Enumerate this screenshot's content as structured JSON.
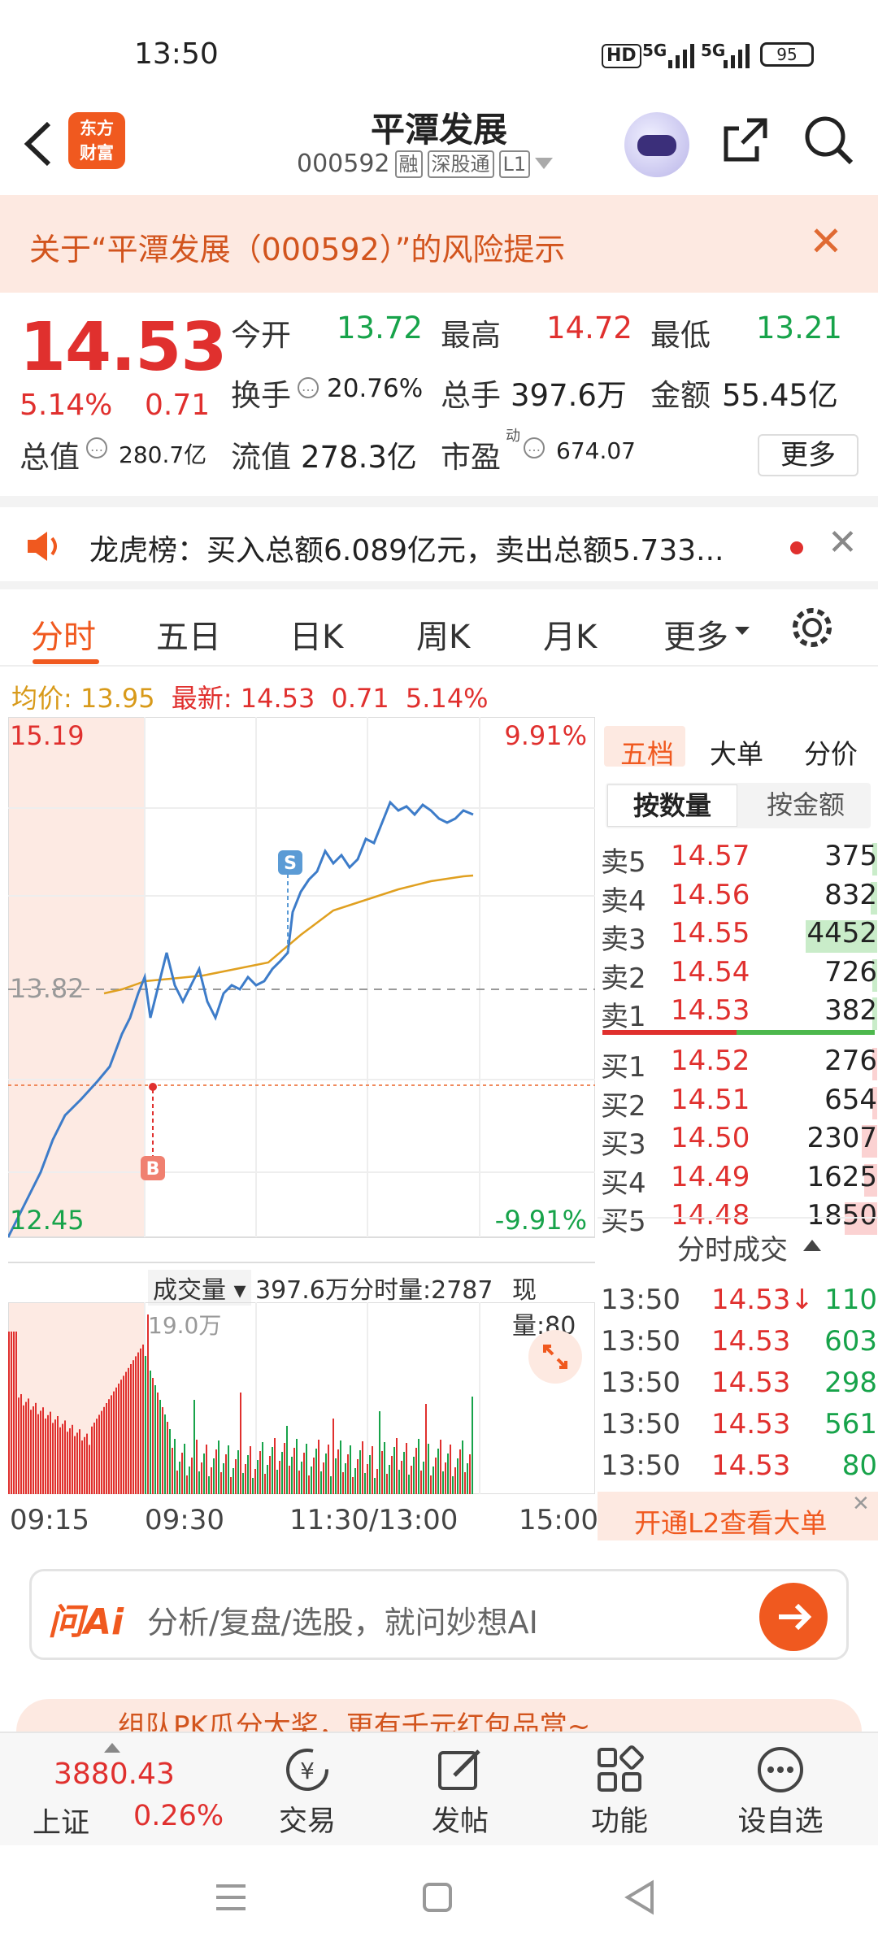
{
  "status": {
    "time": "13:50",
    "hd": "HD",
    "sig1": "5G",
    "sig2": "5G",
    "battery": "95"
  },
  "header": {
    "logo_line1": "东方",
    "logo_line2": "财富",
    "title": "平潭发展",
    "code": "000592",
    "tag1": "融",
    "tag2": "深股通",
    "tag3": "L1"
  },
  "risk_banner": {
    "text": "关于“平潭发展（000592）”的风险提示"
  },
  "quote": {
    "price": "14.53",
    "change_pct": "5.14%",
    "change": "0.71",
    "open_label": "今开",
    "open": "13.72",
    "high_label": "最高",
    "high": "14.72",
    "low_label": "最低",
    "low": "13.21",
    "turnover_label": "换手",
    "turnover": "20.76%",
    "volume_label": "总手",
    "volume": "397.6万",
    "amount_label": "金额",
    "amount": "55.45亿",
    "mktcap_label": "总值",
    "mktcap": "280.7亿",
    "float_label": "流值",
    "float": "278.3亿",
    "pe_label": "市盈",
    "pe_sup": "动",
    "pe": "674.07",
    "more": "更多"
  },
  "notice": {
    "text": "龙虎榜：买入总额6.089亿元，卖出总额5.733..."
  },
  "tabs": [
    "分时",
    "五日",
    "日K",
    "周K",
    "月K",
    "更多"
  ],
  "avg_bar": {
    "avg_label": "均价:",
    "avg": "13.95",
    "latest_label": "最新:",
    "latest": "14.53",
    "chg": "0.71",
    "pct": "5.14%"
  },
  "chart": {
    "top_price": "15.19",
    "top_pct": "9.91%",
    "mid_price": "13.82",
    "low_price": "12.45",
    "low_pct": "-9.91%",
    "marker_s": "S",
    "marker_b": "B",
    "vol_label": "成交量",
    "vol_total": "397.6万",
    "vol_slice": "分时量:2787",
    "vol_now": "现量:80",
    "vol_max": "19.0万",
    "times": [
      "09:15",
      "09:30",
      "11:30/13:00",
      "15:00"
    ]
  },
  "orderbook": {
    "tabs": [
      "五档",
      "大单",
      "分价"
    ],
    "subtabs": [
      "按数量",
      "按金额"
    ],
    "asks": [
      {
        "label": "卖5",
        "price": "14.57",
        "qty": "375",
        "bar": 0.02
      },
      {
        "label": "卖4",
        "price": "14.56",
        "qty": "832",
        "bar": 0.05
      },
      {
        "label": "卖3",
        "price": "14.55",
        "qty": "4452",
        "bar": 0.55
      },
      {
        "label": "卖2",
        "price": "14.54",
        "qty": "726",
        "bar": 0.04
      },
      {
        "label": "卖1",
        "price": "14.53",
        "qty": "382",
        "bar": 0.02
      }
    ],
    "bids": [
      {
        "label": "买1",
        "price": "14.52",
        "qty": "276",
        "bar": 0.02
      },
      {
        "label": "买2",
        "price": "14.51",
        "qty": "654",
        "bar": 0.03
      },
      {
        "label": "买3",
        "price": "14.50",
        "qty": "2307",
        "bar": 0.12
      },
      {
        "label": "买4",
        "price": "14.49",
        "qty": "1625",
        "bar": 0.1
      },
      {
        "label": "买5",
        "price": "14.48",
        "qty": "1850",
        "bar": 0.25
      }
    ],
    "trades_label": "分时成交",
    "trades": [
      {
        "time": "13:50",
        "price": "14.53↓",
        "qty": "110"
      },
      {
        "time": "13:50",
        "price": "14.53",
        "qty": "603"
      },
      {
        "time": "13:50",
        "price": "14.53",
        "qty": "298"
      },
      {
        "time": "13:50",
        "price": "14.53",
        "qty": "561"
      },
      {
        "time": "13:50",
        "price": "14.53",
        "qty": "80"
      }
    ],
    "l2_link": "开通L2查看大单"
  },
  "ai": {
    "logo": "问Ai",
    "placeholder": "分析/复盘/选股，就问妙想AI"
  },
  "peek": {
    "text": "组队PK瓜分大奖，更有千元红包品赏~"
  },
  "nav": {
    "index_value": "3880.43",
    "index_name": "上证",
    "index_pct": "0.26%",
    "items": [
      "交易",
      "发帖",
      "功能",
      "设自选"
    ]
  }
}
